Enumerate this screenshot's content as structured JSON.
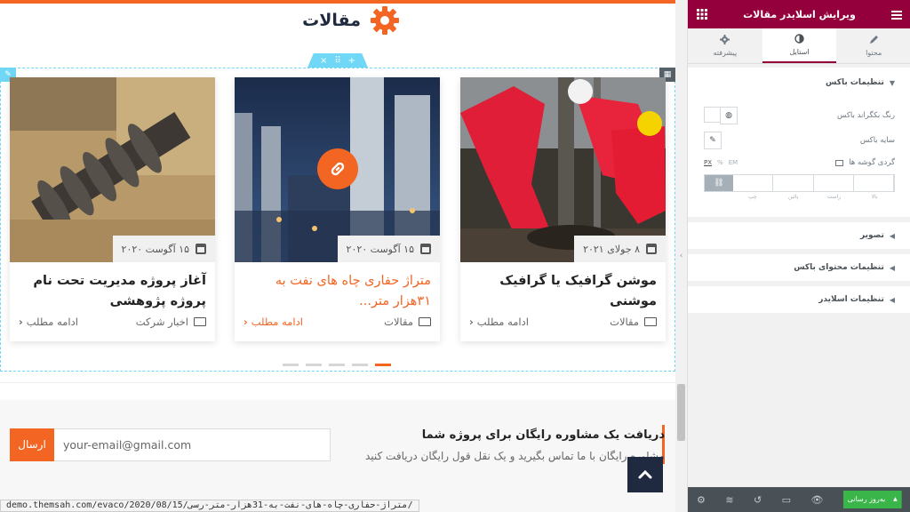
{
  "preview": {
    "section_title": "مقالات",
    "handle": {
      "close": "×",
      "move": "⠿",
      "add": "+"
    },
    "cards": [
      {
        "date": "۸ جولای ۲۰۲۱",
        "title": "موشن گرافیک یا گرافیک موشنی",
        "category": "مقالات",
        "more": "ادامه مطلب",
        "highlight": false
      },
      {
        "date": "۱۵ آگوست ۲۰۲۰",
        "title": "متراژ حفاری چاه های نفت به ۳۱هزار متر...",
        "category": "مقالات",
        "more": "ادامه مطلب",
        "highlight": true
      },
      {
        "date": "۱۵ آگوست ۲۰۲۰",
        "title": "آغاز پروژه مدیریت تحت نام پروژه پژوهشی",
        "category": "اخبار شرکت",
        "more": "ادامه مطلب",
        "highlight": false
      }
    ],
    "dots": {
      "count": 5,
      "active_index_from_right": 0
    },
    "newsletter": {
      "title": "دریافت یک مشاوره رایگان برای پروژه شما",
      "subtitle": "مشاوره رایگان با ما تماس بگیرید و یک نقل قول رایگان دریافت کنید",
      "placeholder": "your-email@gmail.com",
      "button": "ارسال"
    },
    "status_url": "demo.themsah.com/evaco/2020/08/15/متراژ-حفاری-چاه-های-نفت-به-31هزار-متر-رسی/",
    "accent": "#f26522",
    "dark": "#1f2940"
  },
  "panel": {
    "header_title": "ویرایش اسلایدر مقالات",
    "tabs": [
      {
        "label": "محتوا",
        "icon": "pencil-icon"
      },
      {
        "label": "استایل",
        "icon": "contrast-icon"
      },
      {
        "label": "پیشرفته",
        "icon": "gear-icon"
      }
    ],
    "box_settings": {
      "title": "تنظیمات باکس",
      "bg_color": "رنگ بکگراند باکس",
      "shadow": "سایه باکس",
      "radius": "گردی گوشه ها",
      "units": [
        "PX",
        "%",
        "EM"
      ],
      "dims": [
        "بالا",
        "راست",
        "پائین",
        "چپ"
      ]
    },
    "sections": [
      "تصویر",
      "تنظیمات محتوای باکس",
      "تنظیمات اسلایدر"
    ],
    "publish": "به‌روز رسانی",
    "header_color": "#93003c",
    "publish_color": "#39b54a"
  }
}
